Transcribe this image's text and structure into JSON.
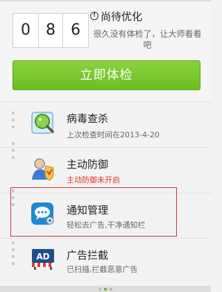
{
  "score": {
    "digits": [
      "0",
      "8",
      "6"
    ]
  },
  "status": {
    "icon": "info-icon",
    "title": "尚待优化",
    "description": "很久没有体检了，让大师看看吧"
  },
  "cta": {
    "label": "立即体检"
  },
  "items": [
    {
      "title": "病毒查杀",
      "subtitle": "上次检查时间在2013-4-20",
      "icon": "virus-scan-icon",
      "subtitle_color": "#666666"
    },
    {
      "title": "主动防御",
      "subtitle": "主动防御未开启",
      "icon": "shield-user-icon",
      "subtitle_color": "#e2342a"
    },
    {
      "title": "通知管理",
      "subtitle": "轻松去广告,干净通知栏",
      "icon": "notification-chat-icon",
      "subtitle_color": "#666666"
    },
    {
      "title": "广告拦截",
      "subtitle": "已扫描,拦截恶意广告",
      "icon": "ad-block-icon",
      "subtitle_color": "#666666"
    }
  ],
  "colors": {
    "accent_green": "#6bbf20",
    "alert_red": "#e2342a",
    "highlight_border": "#c6333c"
  }
}
